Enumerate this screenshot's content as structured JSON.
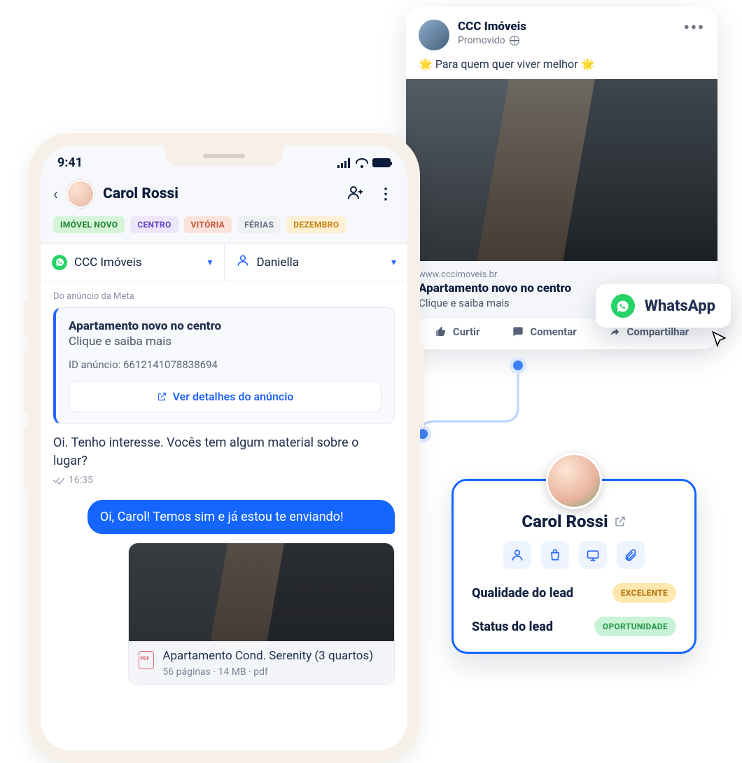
{
  "statusbar": {
    "time": "9:41"
  },
  "contact": {
    "name": "Carol Rossi"
  },
  "tags": [
    {
      "text": "IMÓVEL NOVO",
      "cls": "tag-green"
    },
    {
      "text": "CENTRO",
      "cls": "tag-purple"
    },
    {
      "text": "VITÓRIA",
      "cls": "tag-salmon"
    },
    {
      "text": "FÉRIAS",
      "cls": "tag-grey"
    },
    {
      "text": "DEZEMBRO",
      "cls": "tag-amber"
    }
  ],
  "selectors": {
    "channel": "CCC Imóveis",
    "agent": "Daniella"
  },
  "ad": {
    "source_label": "Do anúncio da Meta",
    "title": "Apartamento novo no centro",
    "subtitle": "Clique e saiba mais",
    "id_label": "ID anúncio: 6612141078838694",
    "button": "Ver detalhes do anúncio"
  },
  "messages": {
    "in": "Oi. Tenho interesse. Vocês tem algum material sobre o lugar?",
    "in_time": "16:35",
    "out": "Oi, Carol! Temos sim e já estou te enviando!"
  },
  "attachment": {
    "title": "Apartamento Cond. Serenity (3 quartos)",
    "meta": "56 páginas · 14 MB · pdf"
  },
  "post": {
    "page": "CCC Imóveis",
    "promoted": "Promovido",
    "caption": "🌟 Para quem quer viver melhor 🌟",
    "domain": "www.cccimoveis.br",
    "title": "Apartamento novo no centro",
    "cta": "Clique e saiba mais",
    "actions": {
      "like": "Curtir",
      "comment": "Comentar",
      "share": "Compartilhar"
    }
  },
  "whatsapp_chip": "WhatsApp",
  "lead": {
    "name": "Carol Rossi",
    "quality_label": "Qualidade do lead",
    "quality_value": "EXCELENTE",
    "status_label": "Status do lead",
    "status_value": "OPORTUNIDADE"
  }
}
